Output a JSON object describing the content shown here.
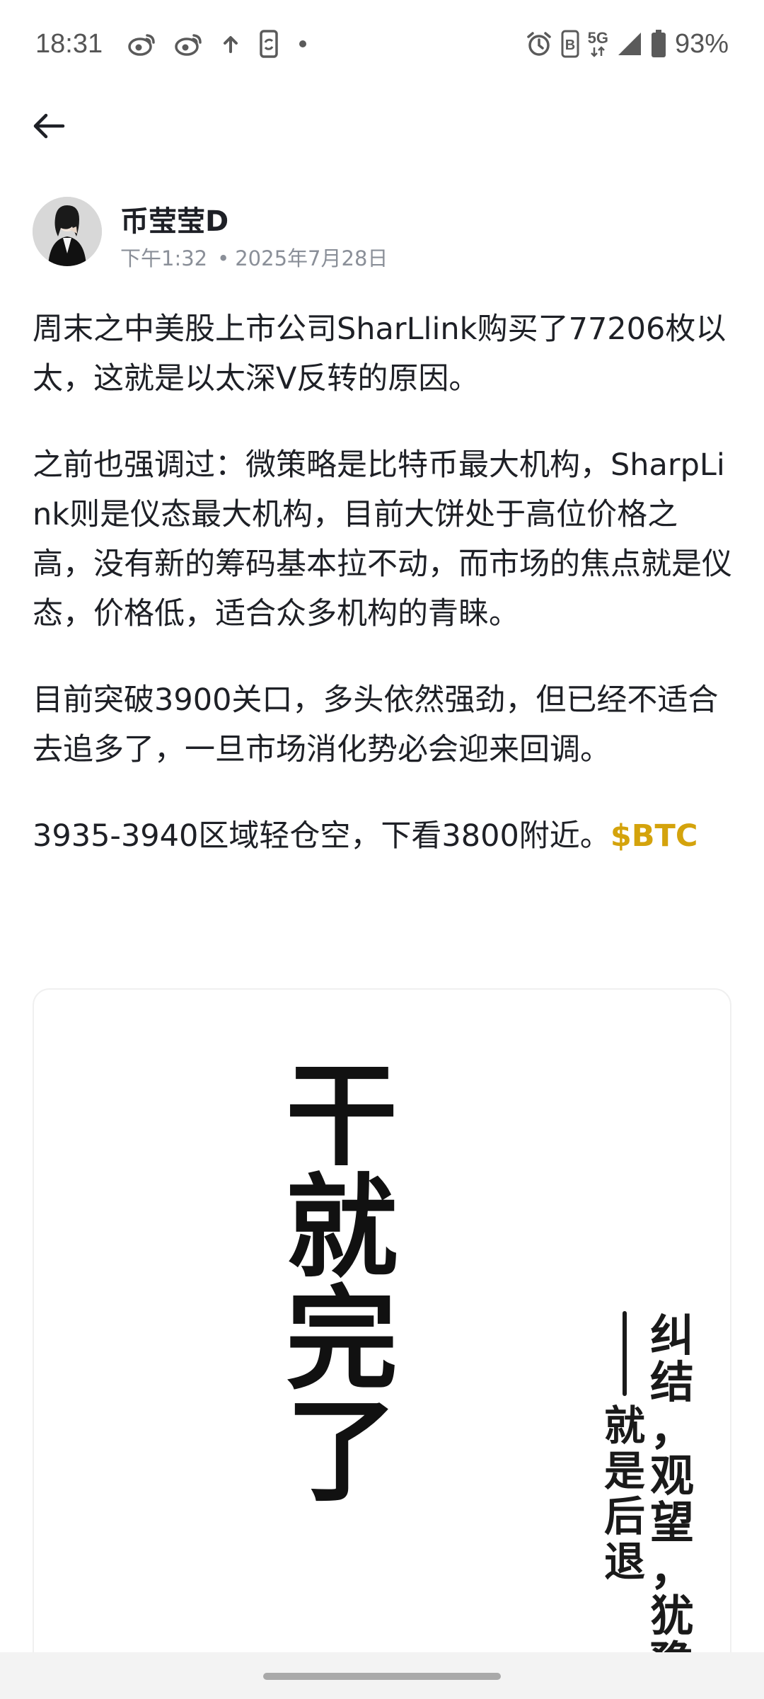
{
  "status_bar": {
    "time": "18:31",
    "battery_text": "93%",
    "network_label": "5G",
    "icons_left": [
      "weibo-icon",
      "weibo-icon",
      "upload-arrow-icon",
      "phone-sync-icon",
      "dot-icon"
    ],
    "icons_right": [
      "alarm-icon",
      "b-badge-icon",
      "5g-icon",
      "signal-icon",
      "battery-icon"
    ]
  },
  "nav": {
    "back_icon": "back-arrow-icon"
  },
  "author": {
    "name": "币莹莹D",
    "time": "下午1:32",
    "separator": "•",
    "date": "2025年7月28日"
  },
  "post": {
    "paragraphs": [
      "周末之中美股上市公司SharLlink购买了77206枚以太，这就是以太深V反转的原因。",
      "之前也强调过：微策略是比特币最大机构，SharpLink则是仪态最大机构，目前大饼处于高位价格之高，没有新的筹码基本拉不动，而市场的焦点就是仪态，价格低，适合众多机构的青睐。",
      "目前突破3900关口，多头依然强劲，但已经不适合去追多了，一旦市场消化势必会迎来回调。"
    ],
    "last_paragraph_text": "3935-3940区域轻仓空，下看3800附近。",
    "coin_tag": "$BTC",
    "coin_tag_color": "#d4a30c"
  },
  "image": {
    "main_chars": [
      "干",
      "就",
      "完",
      "了"
    ],
    "side_chars": [
      "纠",
      "结",
      "，",
      "观",
      "望",
      "，",
      "犹",
      "豫"
    ],
    "attribution_chars": [
      "就",
      "是",
      "后",
      "退"
    ]
  }
}
